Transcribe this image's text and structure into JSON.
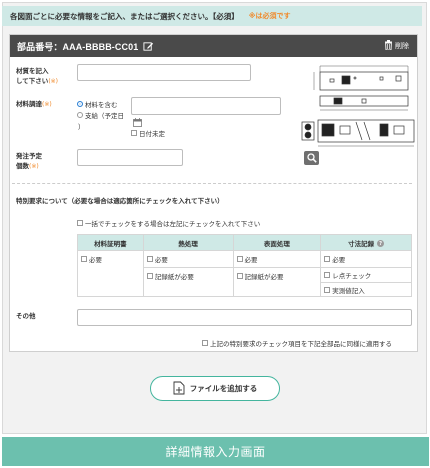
{
  "instructions": {
    "text": "各図面ごとに必要な情報をご記入、またはご選択ください。【必須】",
    "required_note": "※は必須です"
  },
  "part": {
    "number_label": "部品番号：AAA-BBBB-CC01",
    "delete_label": "削除"
  },
  "fields": {
    "material_input": {
      "label_line1": "材質を記入",
      "label_line2": "して下さい",
      "required_mark": "(※)",
      "value": ""
    },
    "material_supply": {
      "label": "材料調達",
      "required_mark": "(※)",
      "option_included": "材料を含む",
      "option_supplied": "支給（予定日",
      "option_supplied_close": "）",
      "date_value": "",
      "undecided_label": "日付未定",
      "selected": "材料を含む"
    },
    "quantity": {
      "label_line1": "発注予定",
      "label_line2": "個数",
      "required_mark": "(※)",
      "value": ""
    }
  },
  "special": {
    "title": "特別要求について（必要な場合は適応箇所にチェックを入れて下さい）",
    "bulk_check_label": "一括でチェックをする場合は左記にチェックを入れて下さい",
    "columns": [
      "材料証明書",
      "熱処理",
      "表面処理",
      "寸法記録"
    ],
    "row1": [
      "必要",
      "必要",
      "必要",
      "必要"
    ],
    "row2": {
      "heat": "記録紙が必要",
      "surface": "記録紙が必要",
      "dim_check": "レ点チェック",
      "dim_record": "実測値記入"
    },
    "other_label": "その他",
    "other_value": "",
    "apply_all_label": "上記の特別要求のチェック項目を下記全部品に同様に適用する"
  },
  "add_file_label": "ファイルを追加する",
  "footer_caption": "詳細情報入力画面",
  "colors": {
    "accent": "#cfe9e6",
    "header_dark": "#4a4a4a",
    "required": "#f08a2c",
    "footer": "#6cc0ae",
    "button_border": "#44b59e"
  },
  "icons": [
    "edit-icon",
    "trash-icon",
    "calendar-icon",
    "magnifier-icon",
    "help-icon",
    "file-add-icon"
  ]
}
